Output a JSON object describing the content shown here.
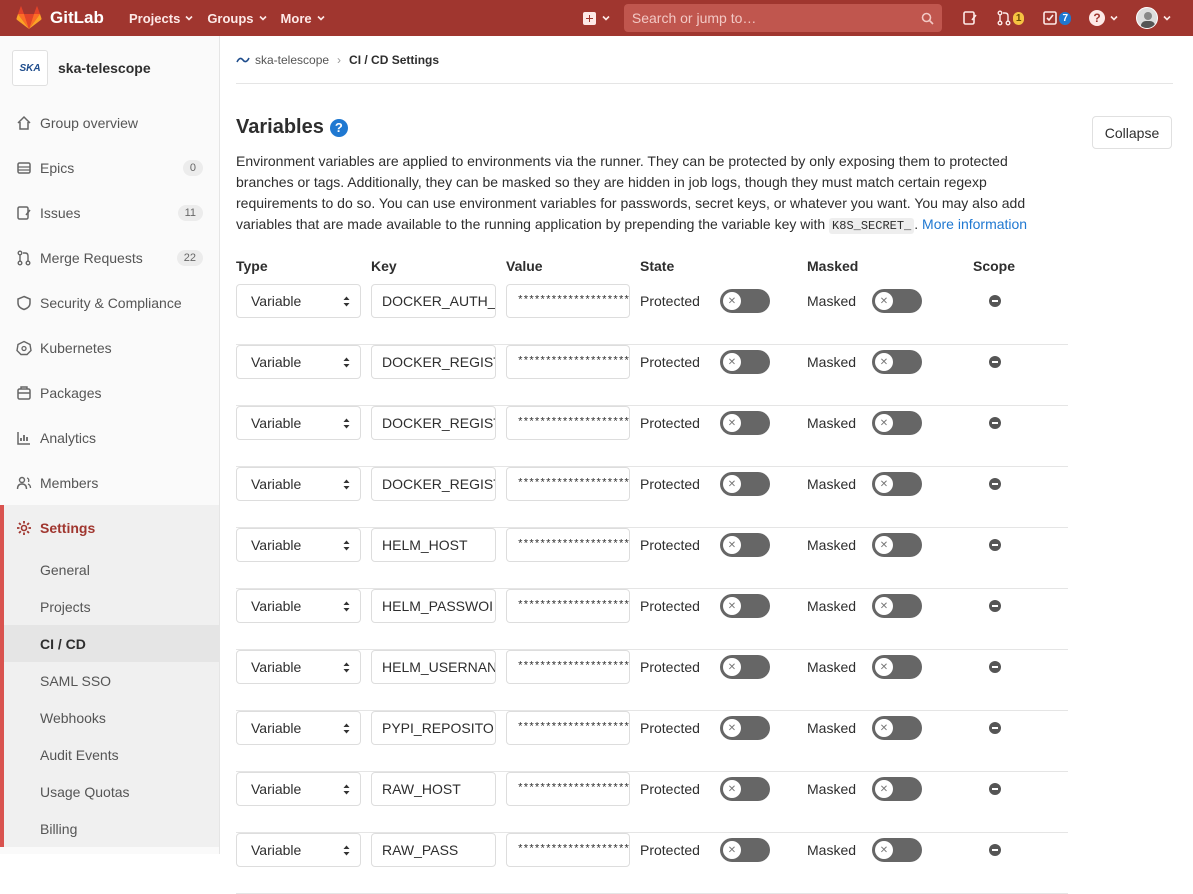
{
  "navbar": {
    "brand": "GitLab",
    "links": [
      "Projects",
      "Groups",
      "More"
    ],
    "search_placeholder": "Search or jump to…",
    "merge_requests_count": "1",
    "todos_count": "7"
  },
  "sidebar": {
    "group_logo_text": "SKA",
    "group_name": "ska-telescope",
    "items": [
      {
        "label": "Group overview",
        "icon": "home-icon"
      },
      {
        "label": "Epics",
        "icon": "epic-icon",
        "count": "0"
      },
      {
        "label": "Issues",
        "icon": "issues-icon",
        "count": "11"
      },
      {
        "label": "Merge Requests",
        "icon": "merge-request-icon",
        "count": "22"
      },
      {
        "label": "Security & Compliance",
        "icon": "shield-icon"
      },
      {
        "label": "Kubernetes",
        "icon": "kubernetes-icon"
      },
      {
        "label": "Packages",
        "icon": "package-icon"
      },
      {
        "label": "Analytics",
        "icon": "chart-icon"
      },
      {
        "label": "Members",
        "icon": "users-icon"
      }
    ],
    "settings_label": "Settings",
    "settings_sub": [
      "General",
      "Projects",
      "CI / CD",
      "SAML SSO",
      "Webhooks",
      "Audit Events",
      "Usage Quotas",
      "Billing"
    ]
  },
  "breadcrumb": {
    "group": "ska-telescope",
    "current": "CI / CD Settings"
  },
  "variables": {
    "title": "Variables",
    "collapse_label": "Collapse",
    "description_1": "Environment variables are applied to environments via the runner. They can be protected by only exposing them to protected branches or tags. Additionally, they can be masked so they are hidden in job logs, though they must match certain regexp requirements to do so. You can use environment variables for passwords, secret keys, or whatever you want. You may also add variables that are made available to the running application by prepending the variable key with ",
    "code": "K8S_SECRET_",
    "description_2": ". ",
    "more_info": "More information",
    "headers": {
      "type": "Type",
      "key": "Key",
      "value": "Value",
      "state": "State",
      "masked": "Masked",
      "scope": "Scope"
    },
    "protected_label": "Protected",
    "masked_label": "Masked",
    "rows": [
      {
        "type": "Variable",
        "key": "DOCKER_AUTH_",
        "value": "********************"
      },
      {
        "type": "Variable",
        "key": "DOCKER_REGIST",
        "value": "********************"
      },
      {
        "type": "Variable",
        "key": "DOCKER_REGIST",
        "value": "********************"
      },
      {
        "type": "Variable",
        "key": "DOCKER_REGIST",
        "value": "********************"
      },
      {
        "type": "Variable",
        "key": "HELM_HOST",
        "value": "********************"
      },
      {
        "type": "Variable",
        "key": "HELM_PASSWOI",
        "value": "********************"
      },
      {
        "type": "Variable",
        "key": "HELM_USERNAN",
        "value": "********************"
      },
      {
        "type": "Variable",
        "key": "PYPI_REPOSITOI",
        "value": "********************"
      },
      {
        "type": "Variable",
        "key": "RAW_HOST",
        "value": "********************"
      },
      {
        "type": "Variable",
        "key": "RAW_PASS",
        "value": "********************"
      }
    ]
  }
}
